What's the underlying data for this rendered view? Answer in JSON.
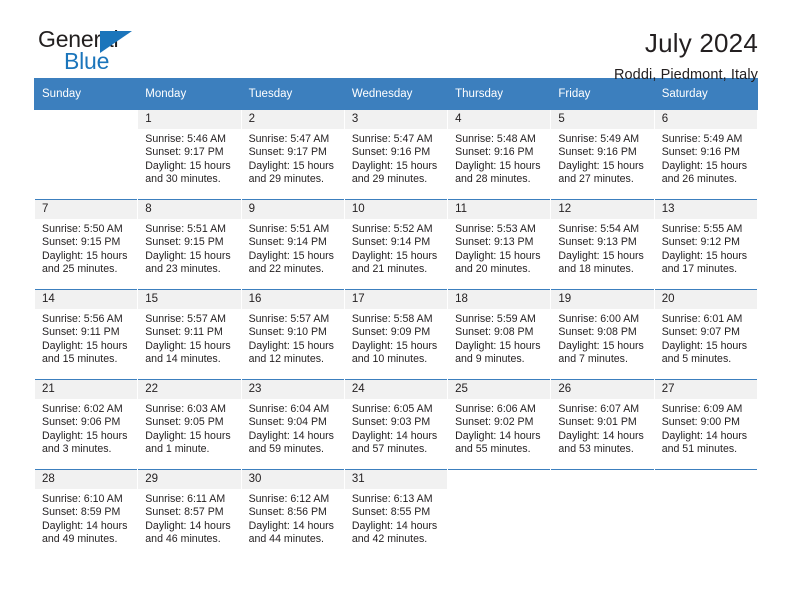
{
  "logo": {
    "word_one": "General",
    "word_two": "Blue",
    "triangle_color": "#1b75bb"
  },
  "header": {
    "title": "July 2024",
    "subtitle": "Roddi, Piedmont, Italy"
  },
  "theme": {
    "header_bg": "#3c7fbe",
    "header_text": "#ffffff",
    "daynum_bg": "#f1f1f1",
    "body_text": "#231f20"
  },
  "calendar": {
    "weekday_headers": [
      "Sunday",
      "Monday",
      "Tuesday",
      "Wednesday",
      "Thursday",
      "Friday",
      "Saturday"
    ],
    "weeks": [
      [
        {
          "day": "",
          "sunrise": "",
          "sunset": "",
          "daylight_line1": "",
          "daylight_line2": ""
        },
        {
          "day": "1",
          "sunrise": "Sunrise: 5:46 AM",
          "sunset": "Sunset: 9:17 PM",
          "daylight_line1": "Daylight: 15 hours",
          "daylight_line2": "and 30 minutes."
        },
        {
          "day": "2",
          "sunrise": "Sunrise: 5:47 AM",
          "sunset": "Sunset: 9:17 PM",
          "daylight_line1": "Daylight: 15 hours",
          "daylight_line2": "and 29 minutes."
        },
        {
          "day": "3",
          "sunrise": "Sunrise: 5:47 AM",
          "sunset": "Sunset: 9:16 PM",
          "daylight_line1": "Daylight: 15 hours",
          "daylight_line2": "and 29 minutes."
        },
        {
          "day": "4",
          "sunrise": "Sunrise: 5:48 AM",
          "sunset": "Sunset: 9:16 PM",
          "daylight_line1": "Daylight: 15 hours",
          "daylight_line2": "and 28 minutes."
        },
        {
          "day": "5",
          "sunrise": "Sunrise: 5:49 AM",
          "sunset": "Sunset: 9:16 PM",
          "daylight_line1": "Daylight: 15 hours",
          "daylight_line2": "and 27 minutes."
        },
        {
          "day": "6",
          "sunrise": "Sunrise: 5:49 AM",
          "sunset": "Sunset: 9:16 PM",
          "daylight_line1": "Daylight: 15 hours",
          "daylight_line2": "and 26 minutes."
        }
      ],
      [
        {
          "day": "7",
          "sunrise": "Sunrise: 5:50 AM",
          "sunset": "Sunset: 9:15 PM",
          "daylight_line1": "Daylight: 15 hours",
          "daylight_line2": "and 25 minutes."
        },
        {
          "day": "8",
          "sunrise": "Sunrise: 5:51 AM",
          "sunset": "Sunset: 9:15 PM",
          "daylight_line1": "Daylight: 15 hours",
          "daylight_line2": "and 23 minutes."
        },
        {
          "day": "9",
          "sunrise": "Sunrise: 5:51 AM",
          "sunset": "Sunset: 9:14 PM",
          "daylight_line1": "Daylight: 15 hours",
          "daylight_line2": "and 22 minutes."
        },
        {
          "day": "10",
          "sunrise": "Sunrise: 5:52 AM",
          "sunset": "Sunset: 9:14 PM",
          "daylight_line1": "Daylight: 15 hours",
          "daylight_line2": "and 21 minutes."
        },
        {
          "day": "11",
          "sunrise": "Sunrise: 5:53 AM",
          "sunset": "Sunset: 9:13 PM",
          "daylight_line1": "Daylight: 15 hours",
          "daylight_line2": "and 20 minutes."
        },
        {
          "day": "12",
          "sunrise": "Sunrise: 5:54 AM",
          "sunset": "Sunset: 9:13 PM",
          "daylight_line1": "Daylight: 15 hours",
          "daylight_line2": "and 18 minutes."
        },
        {
          "day": "13",
          "sunrise": "Sunrise: 5:55 AM",
          "sunset": "Sunset: 9:12 PM",
          "daylight_line1": "Daylight: 15 hours",
          "daylight_line2": "and 17 minutes."
        }
      ],
      [
        {
          "day": "14",
          "sunrise": "Sunrise: 5:56 AM",
          "sunset": "Sunset: 9:11 PM",
          "daylight_line1": "Daylight: 15 hours",
          "daylight_line2": "and 15 minutes."
        },
        {
          "day": "15",
          "sunrise": "Sunrise: 5:57 AM",
          "sunset": "Sunset: 9:11 PM",
          "daylight_line1": "Daylight: 15 hours",
          "daylight_line2": "and 14 minutes."
        },
        {
          "day": "16",
          "sunrise": "Sunrise: 5:57 AM",
          "sunset": "Sunset: 9:10 PM",
          "daylight_line1": "Daylight: 15 hours",
          "daylight_line2": "and 12 minutes."
        },
        {
          "day": "17",
          "sunrise": "Sunrise: 5:58 AM",
          "sunset": "Sunset: 9:09 PM",
          "daylight_line1": "Daylight: 15 hours",
          "daylight_line2": "and 10 minutes."
        },
        {
          "day": "18",
          "sunrise": "Sunrise: 5:59 AM",
          "sunset": "Sunset: 9:08 PM",
          "daylight_line1": "Daylight: 15 hours",
          "daylight_line2": "and 9 minutes."
        },
        {
          "day": "19",
          "sunrise": "Sunrise: 6:00 AM",
          "sunset": "Sunset: 9:08 PM",
          "daylight_line1": "Daylight: 15 hours",
          "daylight_line2": "and 7 minutes."
        },
        {
          "day": "20",
          "sunrise": "Sunrise: 6:01 AM",
          "sunset": "Sunset: 9:07 PM",
          "daylight_line1": "Daylight: 15 hours",
          "daylight_line2": "and 5 minutes."
        }
      ],
      [
        {
          "day": "21",
          "sunrise": "Sunrise: 6:02 AM",
          "sunset": "Sunset: 9:06 PM",
          "daylight_line1": "Daylight: 15 hours",
          "daylight_line2": "and 3 minutes."
        },
        {
          "day": "22",
          "sunrise": "Sunrise: 6:03 AM",
          "sunset": "Sunset: 9:05 PM",
          "daylight_line1": "Daylight: 15 hours",
          "daylight_line2": "and 1 minute."
        },
        {
          "day": "23",
          "sunrise": "Sunrise: 6:04 AM",
          "sunset": "Sunset: 9:04 PM",
          "daylight_line1": "Daylight: 14 hours",
          "daylight_line2": "and 59 minutes."
        },
        {
          "day": "24",
          "sunrise": "Sunrise: 6:05 AM",
          "sunset": "Sunset: 9:03 PM",
          "daylight_line1": "Daylight: 14 hours",
          "daylight_line2": "and 57 minutes."
        },
        {
          "day": "25",
          "sunrise": "Sunrise: 6:06 AM",
          "sunset": "Sunset: 9:02 PM",
          "daylight_line1": "Daylight: 14 hours",
          "daylight_line2": "and 55 minutes."
        },
        {
          "day": "26",
          "sunrise": "Sunrise: 6:07 AM",
          "sunset": "Sunset: 9:01 PM",
          "daylight_line1": "Daylight: 14 hours",
          "daylight_line2": "and 53 minutes."
        },
        {
          "day": "27",
          "sunrise": "Sunrise: 6:09 AM",
          "sunset": "Sunset: 9:00 PM",
          "daylight_line1": "Daylight: 14 hours",
          "daylight_line2": "and 51 minutes."
        }
      ],
      [
        {
          "day": "28",
          "sunrise": "Sunrise: 6:10 AM",
          "sunset": "Sunset: 8:59 PM",
          "daylight_line1": "Daylight: 14 hours",
          "daylight_line2": "and 49 minutes."
        },
        {
          "day": "29",
          "sunrise": "Sunrise: 6:11 AM",
          "sunset": "Sunset: 8:57 PM",
          "daylight_line1": "Daylight: 14 hours",
          "daylight_line2": "and 46 minutes."
        },
        {
          "day": "30",
          "sunrise": "Sunrise: 6:12 AM",
          "sunset": "Sunset: 8:56 PM",
          "daylight_line1": "Daylight: 14 hours",
          "daylight_line2": "and 44 minutes."
        },
        {
          "day": "31",
          "sunrise": "Sunrise: 6:13 AM",
          "sunset": "Sunset: 8:55 PM",
          "daylight_line1": "Daylight: 14 hours",
          "daylight_line2": "and 42 minutes."
        },
        {
          "day": "",
          "sunrise": "",
          "sunset": "",
          "daylight_line1": "",
          "daylight_line2": ""
        },
        {
          "day": "",
          "sunrise": "",
          "sunset": "",
          "daylight_line1": "",
          "daylight_line2": ""
        },
        {
          "day": "",
          "sunrise": "",
          "sunset": "",
          "daylight_line1": "",
          "daylight_line2": ""
        }
      ]
    ]
  }
}
